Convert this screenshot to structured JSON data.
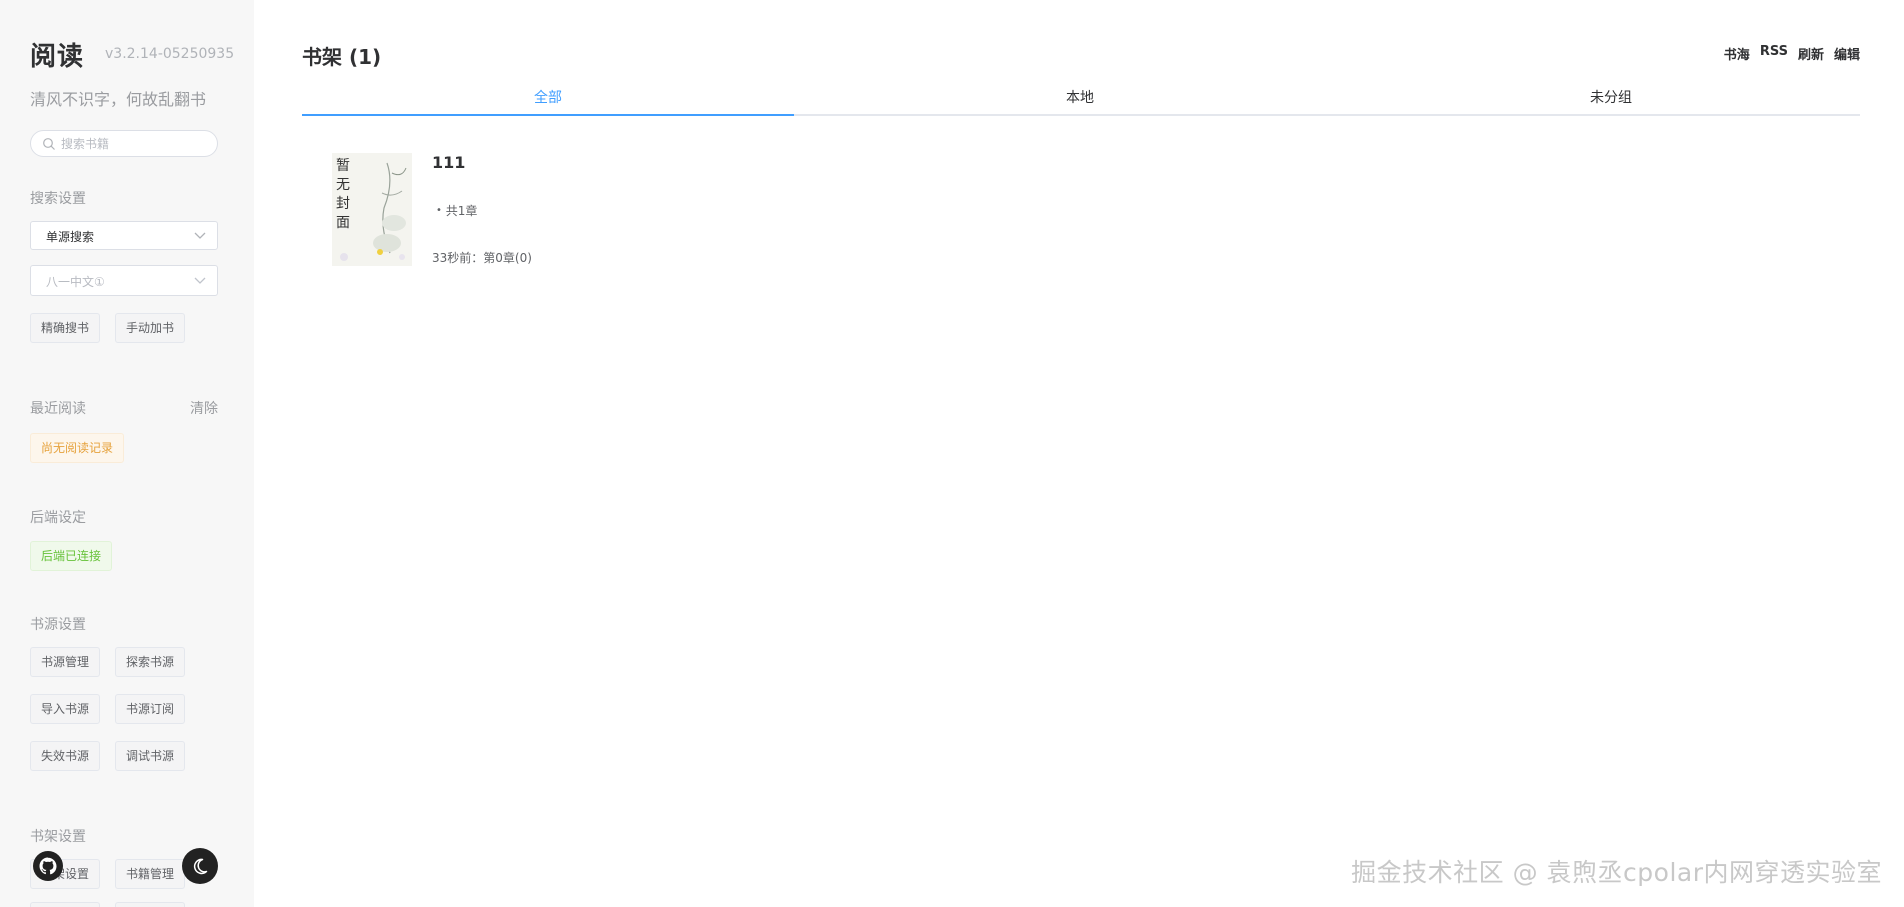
{
  "app": {
    "title": "阅读",
    "version": "v3.2.14-05250935",
    "motto": "清风不识字，何故乱翻书"
  },
  "search": {
    "placeholder": "搜索书籍"
  },
  "sections": {
    "search_settings": "搜索设置",
    "recent_reading": "最近阅读",
    "backend_settings": "后端设定",
    "source_settings": "书源设置",
    "shelf_settings": "书架设置"
  },
  "search_settings": {
    "mode_value": "单源搜索",
    "source_value": "八一中文①",
    "exact_search": "精确搜书",
    "manual_add": "手动加书"
  },
  "recent": {
    "clear_label": "清除",
    "empty_text": "尚无阅读记录"
  },
  "backend": {
    "status": "后端已连接"
  },
  "source_buttons": [
    "书源管理",
    "探索书源",
    "导入书源",
    "书源订阅",
    "失效书源",
    "调试书源"
  ],
  "shelf_buttons": [
    "书架设置",
    "书籍管理"
  ],
  "main": {
    "title": "书架 (1)",
    "actions": [
      "书海",
      "RSS",
      "刷新",
      "编辑"
    ],
    "tabs": [
      "全部",
      "本地",
      "未分组"
    ],
    "active_tab": 0
  },
  "books": [
    {
      "name": "111",
      "meta": "共1章",
      "progress": "33秒前：第0章(0)",
      "cover_text": "暂无封面"
    }
  ],
  "watermark": "掘金技术社区 @ 袁煦丞cpolar内网穿透实验室",
  "colors": {
    "accent": "#409eff",
    "warning": "#e6a23c",
    "success": "#67c23a",
    "sidebar_bg": "#f7f7f7"
  }
}
